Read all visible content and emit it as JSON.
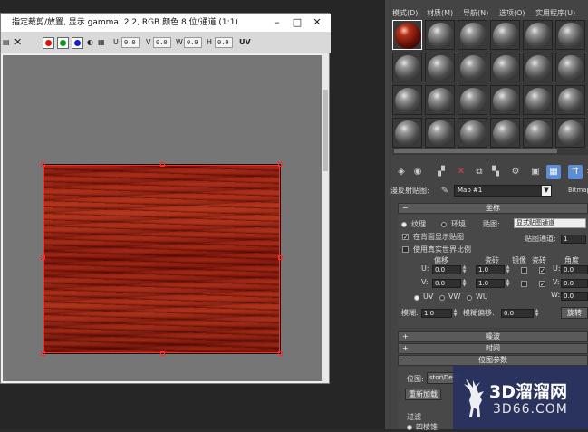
{
  "crop_window": {
    "title": "指定裁剪/放置, 显示 gamma: 2.2, RGB 颜色 8 位/通道 (1:1)",
    "toolbar": {
      "u_label": "U",
      "u_value": "0.0",
      "v_label": "V",
      "v_value": "0.0",
      "w_label": "W",
      "w_value": "0.9",
      "h_label": "H",
      "h_value": "0.9",
      "uv_label": "UV"
    }
  },
  "material_editor": {
    "menu": [
      "模式(D)",
      "材质(M)",
      "导航(N)",
      "选项(O)",
      "实用程序(U)"
    ],
    "map_row": {
      "label": "漫反射贴图:",
      "map_name": "Map #1",
      "map_type": "Bitmap"
    },
    "coordinates": {
      "rollout_title": "坐标",
      "texture_label": "纹理",
      "environ_label": "环境",
      "mapping_label": "贴图:",
      "mapping_value": "显式贴图通道",
      "show_on_back": "在背面显示贴图",
      "map_channel_label": "贴图通道:",
      "map_channel_value": "1",
      "real_world": "使用真实世界比例",
      "offset_header": "偏移",
      "tiling_header": "瓷砖",
      "mirror_header": "镜像",
      "tile_header": "瓷砖",
      "angle_header": "角度",
      "u_label": "U:",
      "v_label": "V:",
      "w_label": "W:",
      "u_offset": "0.0",
      "v_offset": "0.0",
      "u_tiling": "1.0",
      "v_tiling": "1.0",
      "u_angle": "0.0",
      "v_angle": "0.0",
      "w_angle": "0.0",
      "uv": "UV",
      "vw": "VW",
      "wu": "WU",
      "blur_label": "模糊:",
      "blur_value": "1.0",
      "blur_offset_label": "模糊偏移:",
      "blur_offset_value": "0.0",
      "rotate_button": "旋转"
    },
    "noise_title": "噪波",
    "time_title": "时间",
    "bitmap_params_title": "位图参数",
    "bitmap_label": "位图:",
    "bitmap_path": "stor\\Der",
    "reload_button": "重新加载",
    "filter_label": "过滤",
    "filter_option": "四棱锥"
  },
  "watermark": {
    "brand": "3D溜溜网",
    "url": "3D66.COM"
  }
}
